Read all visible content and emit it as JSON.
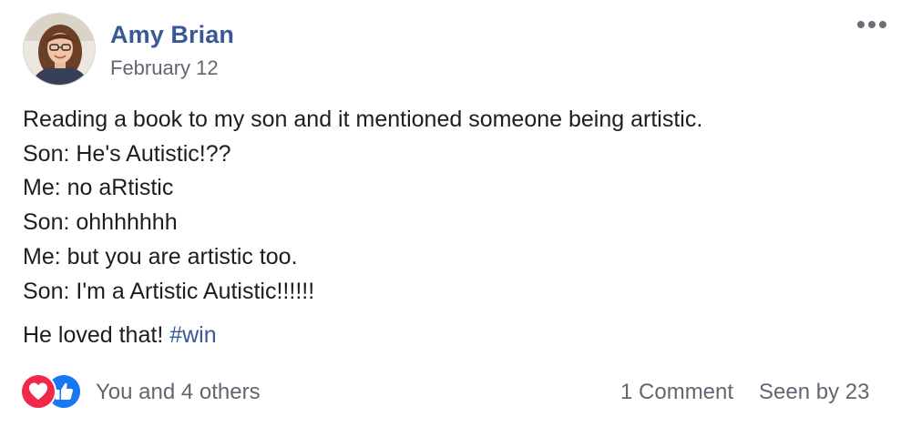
{
  "post": {
    "author": {
      "name": "Amy Brian",
      "avatar_icon": "profile-photo"
    },
    "date": "February 12",
    "menu_icon": "more-horizontal-icon",
    "body_lines": [
      "Reading a book to my son and it mentioned someone being artistic.",
      "Son: He's Autistic!??",
      "Me: no aRtistic",
      "Son: ohhhhhhh",
      "Me: but you are artistic too.",
      "Son: I'm a Artistic Autistic!!!!!!"
    ],
    "closing": {
      "text": "He loved that! ",
      "hashtag": "#win"
    }
  },
  "reactions": {
    "icons": [
      "love-icon",
      "like-icon"
    ],
    "summary": "You and 4 others",
    "comments": "1 Comment",
    "seen": "Seen by 23"
  },
  "colors": {
    "link": "#385898",
    "secondary_text": "#616770",
    "love": "#f0284a",
    "like": "#1877f2"
  }
}
